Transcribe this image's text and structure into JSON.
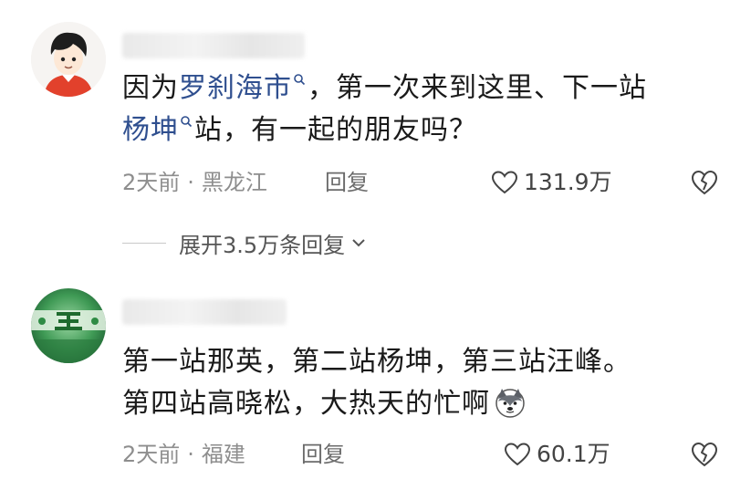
{
  "comments": [
    {
      "text_before_link1": "因为",
      "link1": "罗刹海市",
      "text_after_link1": "，第一次来到这里、下一站",
      "link2": "杨坤",
      "text_after_link2": "站，有一起的朋友吗？",
      "time": "2天前",
      "dot": "·",
      "location": "黑龙江",
      "reply_label": "回复",
      "likes": "131.9万",
      "expand_label": "展开3.5万条回复"
    },
    {
      "line1": "第一站那英，第二站杨坤，第三站汪峰。",
      "line2": "第四站高晓松，大热天的忙啊",
      "time": "2天前",
      "dot": "·",
      "location": "福建",
      "reply_label": "回复",
      "likes": "60.1万"
    }
  ],
  "icons": {
    "like": "heart-outline-icon",
    "dislike": "broken-heart-icon",
    "expand": "chevron-down-icon",
    "link_search": "search-mini-icon",
    "emoji": "husky-emoji-icon"
  },
  "colors": {
    "link": "#2f4f8f",
    "meta": "#8e8e8e",
    "text": "#1a1a1a"
  }
}
